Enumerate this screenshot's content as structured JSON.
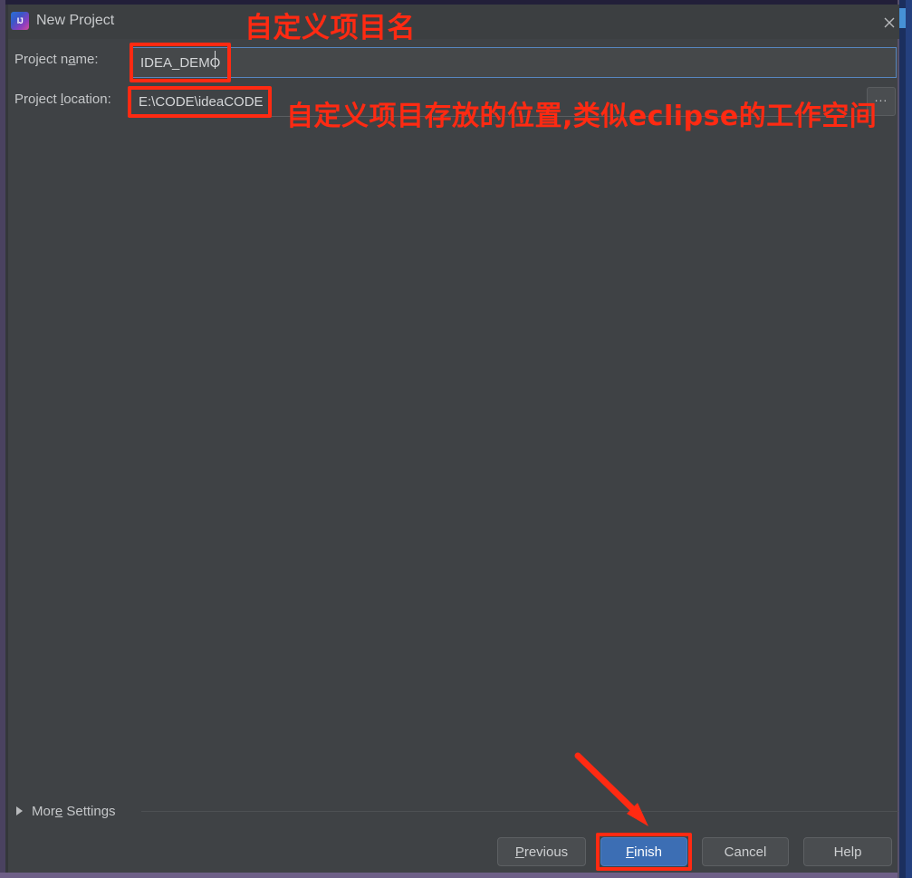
{
  "window": {
    "title": "New Project",
    "app_icon": "intellij-idea-icon",
    "icon_text": "IJ",
    "close_icon": "close-icon"
  },
  "form": {
    "name_label": "Project name:",
    "name_label_prefix": "Project n",
    "name_label_mnemonic": "a",
    "name_label_suffix": "me:",
    "name_value": "IDEA_DEMO",
    "location_label_prefix": "Project ",
    "location_label_mnemonic": "l",
    "location_label_suffix": "ocation:",
    "location_value": "E:\\CODE\\ideaCODE",
    "browse_label": "...",
    "browse_icon": "ellipsis-browse-icon"
  },
  "more_settings": {
    "label_prefix": "Mor",
    "label_mnemonic": "e",
    "label_suffix": " Settings",
    "expander_icon": "triangle-right-icon"
  },
  "buttons": {
    "previous_prefix": "",
    "previous_mnemonic": "P",
    "previous_suffix": "revious",
    "finish_prefix": "",
    "finish_mnemonic": "F",
    "finish_suffix": "inish",
    "cancel": "Cancel",
    "help": "Help"
  },
  "annotations": {
    "note_project_name": "自定义项目名",
    "note_project_location": "自定义项目存放的位置,类似eclipse的工作空间",
    "arrow_icon": "red-arrow-icon",
    "highlight_color": "#ff2a12"
  },
  "colors": {
    "dialog_background": "#3f4245",
    "titlebar_background": "#3c3f41",
    "focus_border": "#5786c0",
    "finish_button": "#3c6eb4",
    "annotation_red": "#ff2a12",
    "window_left_border": "#4a4260",
    "window_bottom_border": "#6e5f87",
    "ide_blue_right": "#24407e"
  }
}
